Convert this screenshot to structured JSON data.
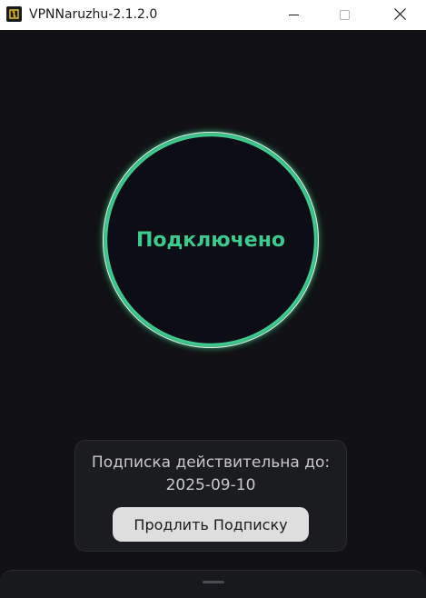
{
  "window": {
    "title": "VPNNaruzhu-2.1.2.0",
    "app_icon": "app-logo-icon",
    "buttons": {
      "minimize_icon": "minimize-icon",
      "maximize_icon": "maximize-icon",
      "close_icon": "close-icon"
    }
  },
  "connection": {
    "status_label": "Подключено",
    "status_color": "#3fc98e",
    "ring_color": "#3fc98e"
  },
  "subscription": {
    "label": "Подписка действительна до:",
    "expires": "2025-09-10",
    "renew_label": "Продлить Подписку"
  },
  "colors": {
    "background": "#111113",
    "card": "#1b1c1f",
    "button": "#dedede"
  }
}
